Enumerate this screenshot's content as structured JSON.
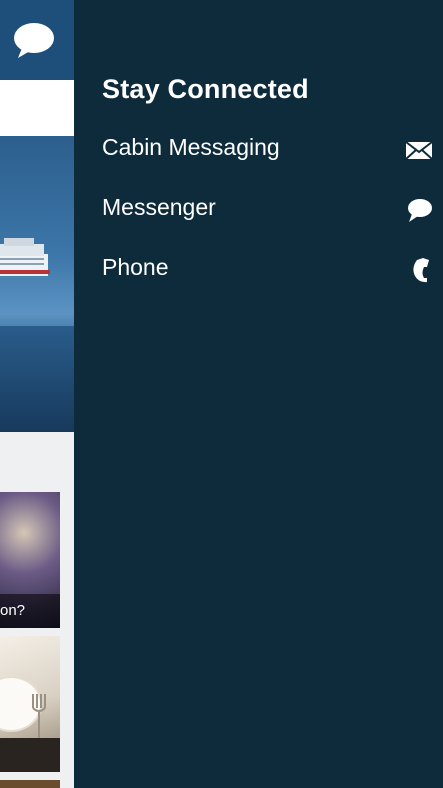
{
  "panel": {
    "title": "Stay Connected",
    "items": [
      {
        "label": "Cabin Messaging",
        "icon": "envelope-icon"
      },
      {
        "label": "Messenger",
        "icon": "chat-bubble-icon"
      },
      {
        "label": "Phone",
        "icon": "phone-icon"
      }
    ]
  },
  "background_app": {
    "header_icon": "chat-bubble-icon",
    "card_caption": "on?"
  },
  "colors": {
    "panel_bg": "#0d2b3b",
    "header_bg": "#1e4e7a",
    "text": "#ffffff"
  }
}
